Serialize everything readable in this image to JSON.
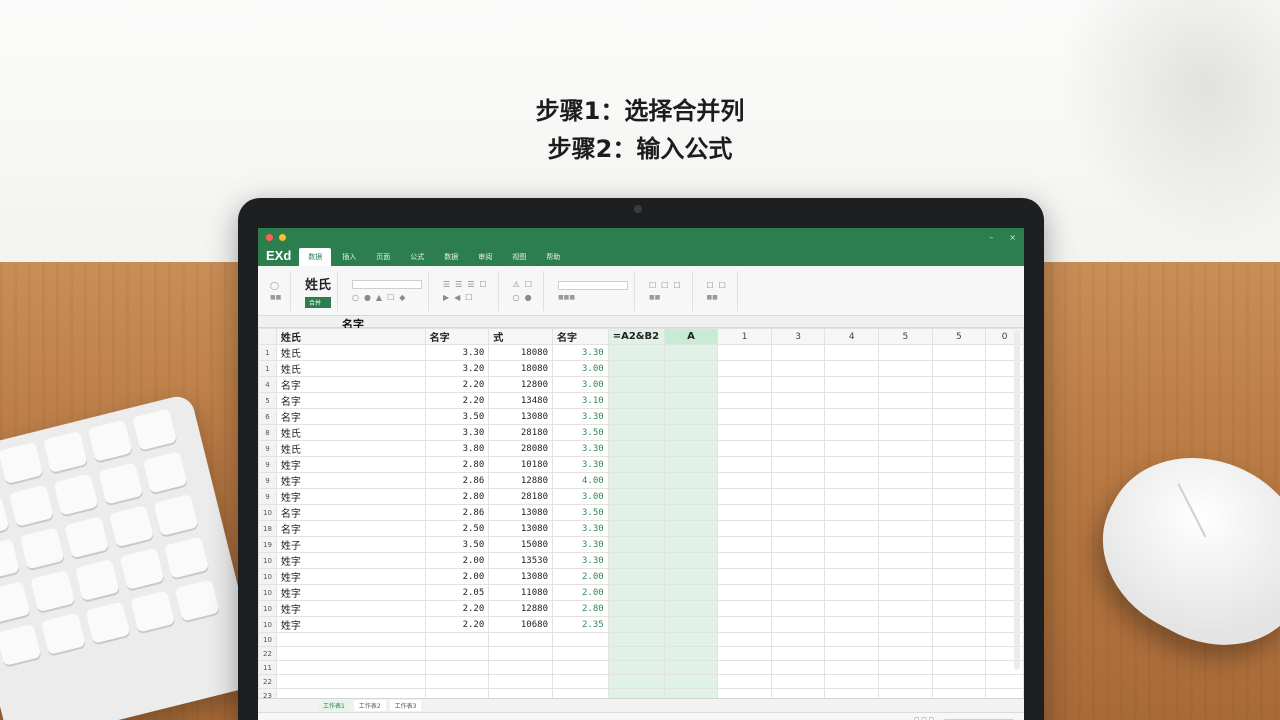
{
  "headline": {
    "line1": "步骤1：选择合并列",
    "line2": "步骤2：输入公式"
  },
  "app": {
    "logo": "EXd",
    "tabs": [
      "数据",
      "插入",
      "页面",
      "公式",
      "数据",
      "审阅",
      "视图",
      "帮助"
    ],
    "active_tab_index": 0,
    "ribbon_big": "姓氏",
    "ribbon_green": "合并"
  },
  "sheet": {
    "name_box": "名字",
    "formula": "=A2&B2",
    "sel_col_header": "A",
    "extra_col_headers": [
      "1",
      "3",
      "4",
      "5",
      "5",
      "0"
    ],
    "headers": [
      "姓氏",
      "名字",
      "式",
      "名字"
    ],
    "rows": [
      {
        "n": "1",
        "a": "姓氏",
        "b": "3.30",
        "c": "18080",
        "d": "3.30"
      },
      {
        "n": "1",
        "a": "姓氏",
        "b": "3.20",
        "c": "18080",
        "d": "3.00"
      },
      {
        "n": "4",
        "a": "名字",
        "b": "2.20",
        "c": "12800",
        "d": "3.00"
      },
      {
        "n": "5",
        "a": "名字",
        "b": "2.20",
        "c": "13480",
        "d": "3.10"
      },
      {
        "n": "6",
        "a": "名字",
        "b": "3.50",
        "c": "13080",
        "d": "3.30"
      },
      {
        "n": "8",
        "a": "姓氏",
        "b": "3.30",
        "c": "28180",
        "d": "3.50"
      },
      {
        "n": "9",
        "a": "姓氏",
        "b": "3.80",
        "c": "28080",
        "d": "3.30"
      },
      {
        "n": "9",
        "a": "姓字",
        "b": "2.80",
        "c": "10180",
        "d": "3.30"
      },
      {
        "n": "9",
        "a": "姓字",
        "b": "2.86",
        "c": "12880",
        "d": "4.00"
      },
      {
        "n": "9",
        "a": "姓字",
        "b": "2.80",
        "c": "28180",
        "d": "3.00"
      },
      {
        "n": "10",
        "a": "名字",
        "b": "2.86",
        "c": "13080",
        "d": "3.50"
      },
      {
        "n": "18",
        "a": "名字",
        "b": "2.50",
        "c": "13080",
        "d": "3.30"
      },
      {
        "n": "19",
        "a": "姓子",
        "b": "3.50",
        "c": "15080",
        "d": "3.30"
      },
      {
        "n": "10",
        "a": "姓字",
        "b": "2.00",
        "c": "13530",
        "d": "3.30"
      },
      {
        "n": "10",
        "a": "姓字",
        "b": "2.00",
        "c": "13080",
        "d": "2.00"
      },
      {
        "n": "10",
        "a": "姓字",
        "b": "2.05",
        "c": "11080",
        "d": "2.00"
      },
      {
        "n": "10",
        "a": "姓字",
        "b": "2.20",
        "c": "12880",
        "d": "2.80"
      },
      {
        "n": "10",
        "a": "姓字",
        "b": "2.20",
        "c": "10680",
        "d": "2.35"
      }
    ],
    "empty_row_numbers": [
      "10",
      "22",
      "11",
      "22",
      "23",
      "23"
    ],
    "sheet_tabs": [
      "工作表1",
      "工作表2",
      "工作表3"
    ]
  },
  "colors": {
    "accent": "#2d7e4f",
    "selection": "#dff2e5"
  }
}
